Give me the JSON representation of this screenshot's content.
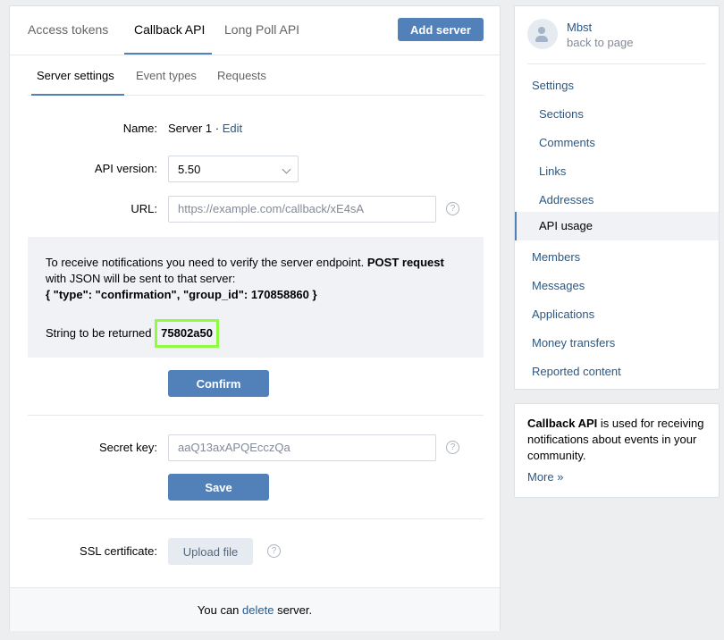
{
  "top_tabs": [
    {
      "label": "Access tokens",
      "active": false
    },
    {
      "label": "Callback API",
      "active": true
    },
    {
      "label": "Long Poll API",
      "active": false
    }
  ],
  "add_server_label": "Add server",
  "sub_tabs": [
    {
      "label": "Server settings",
      "active": true
    },
    {
      "label": "Event types",
      "active": false
    },
    {
      "label": "Requests",
      "active": false
    }
  ],
  "form": {
    "name_label": "Name:",
    "name_value": "Server 1",
    "name_sep": " · ",
    "edit_label": "Edit",
    "api_version_label": "API version:",
    "api_version_value": "5.50",
    "url_label": "URL:",
    "url_value": "https://example.com/callback/xE4sA",
    "secret_label": "Secret key:",
    "secret_value": "aaQ13axAPQEcczQa",
    "ssl_label": "SSL certificate:",
    "upload_label": "Upload file",
    "confirm_label": "Confirm",
    "save_label": "Save",
    "help_glyph": "?"
  },
  "info_box": {
    "line1_pre": "To receive notifications you need to verify the server endpoint. ",
    "line1_bold": "POST request",
    "line2": " with JSON will be sent to that server:",
    "json_line": "{ \"type\": \"confirmation\", \"group_id\": 170858860 }",
    "return_label": "String to be returned",
    "return_value": "75802a50"
  },
  "footer": {
    "pre": "You can ",
    "link": "delete",
    "post": " server."
  },
  "sidebar": {
    "group_name": "Mbst",
    "back_label": "back to page",
    "items": [
      {
        "label": "Settings",
        "type": "head"
      },
      {
        "label": "Sections",
        "type": "sub"
      },
      {
        "label": "Comments",
        "type": "sub"
      },
      {
        "label": "Links",
        "type": "sub"
      },
      {
        "label": "Addresses",
        "type": "sub"
      },
      {
        "label": "API usage",
        "type": "active"
      },
      {
        "label": "Members",
        "type": "head"
      },
      {
        "label": "Messages",
        "type": "head"
      },
      {
        "label": "Applications",
        "type": "head"
      },
      {
        "label": "Money transfers",
        "type": "head"
      },
      {
        "label": "Reported content",
        "type": "head"
      }
    ]
  },
  "info_panel": {
    "bold": "Callback API",
    "text": " is used for receiving notifications about events in your community.",
    "more": "More »"
  },
  "colors": {
    "accent": "#5181b8",
    "link": "#2a5885",
    "highlight": "#8ffb42",
    "background": "#edeef0"
  }
}
